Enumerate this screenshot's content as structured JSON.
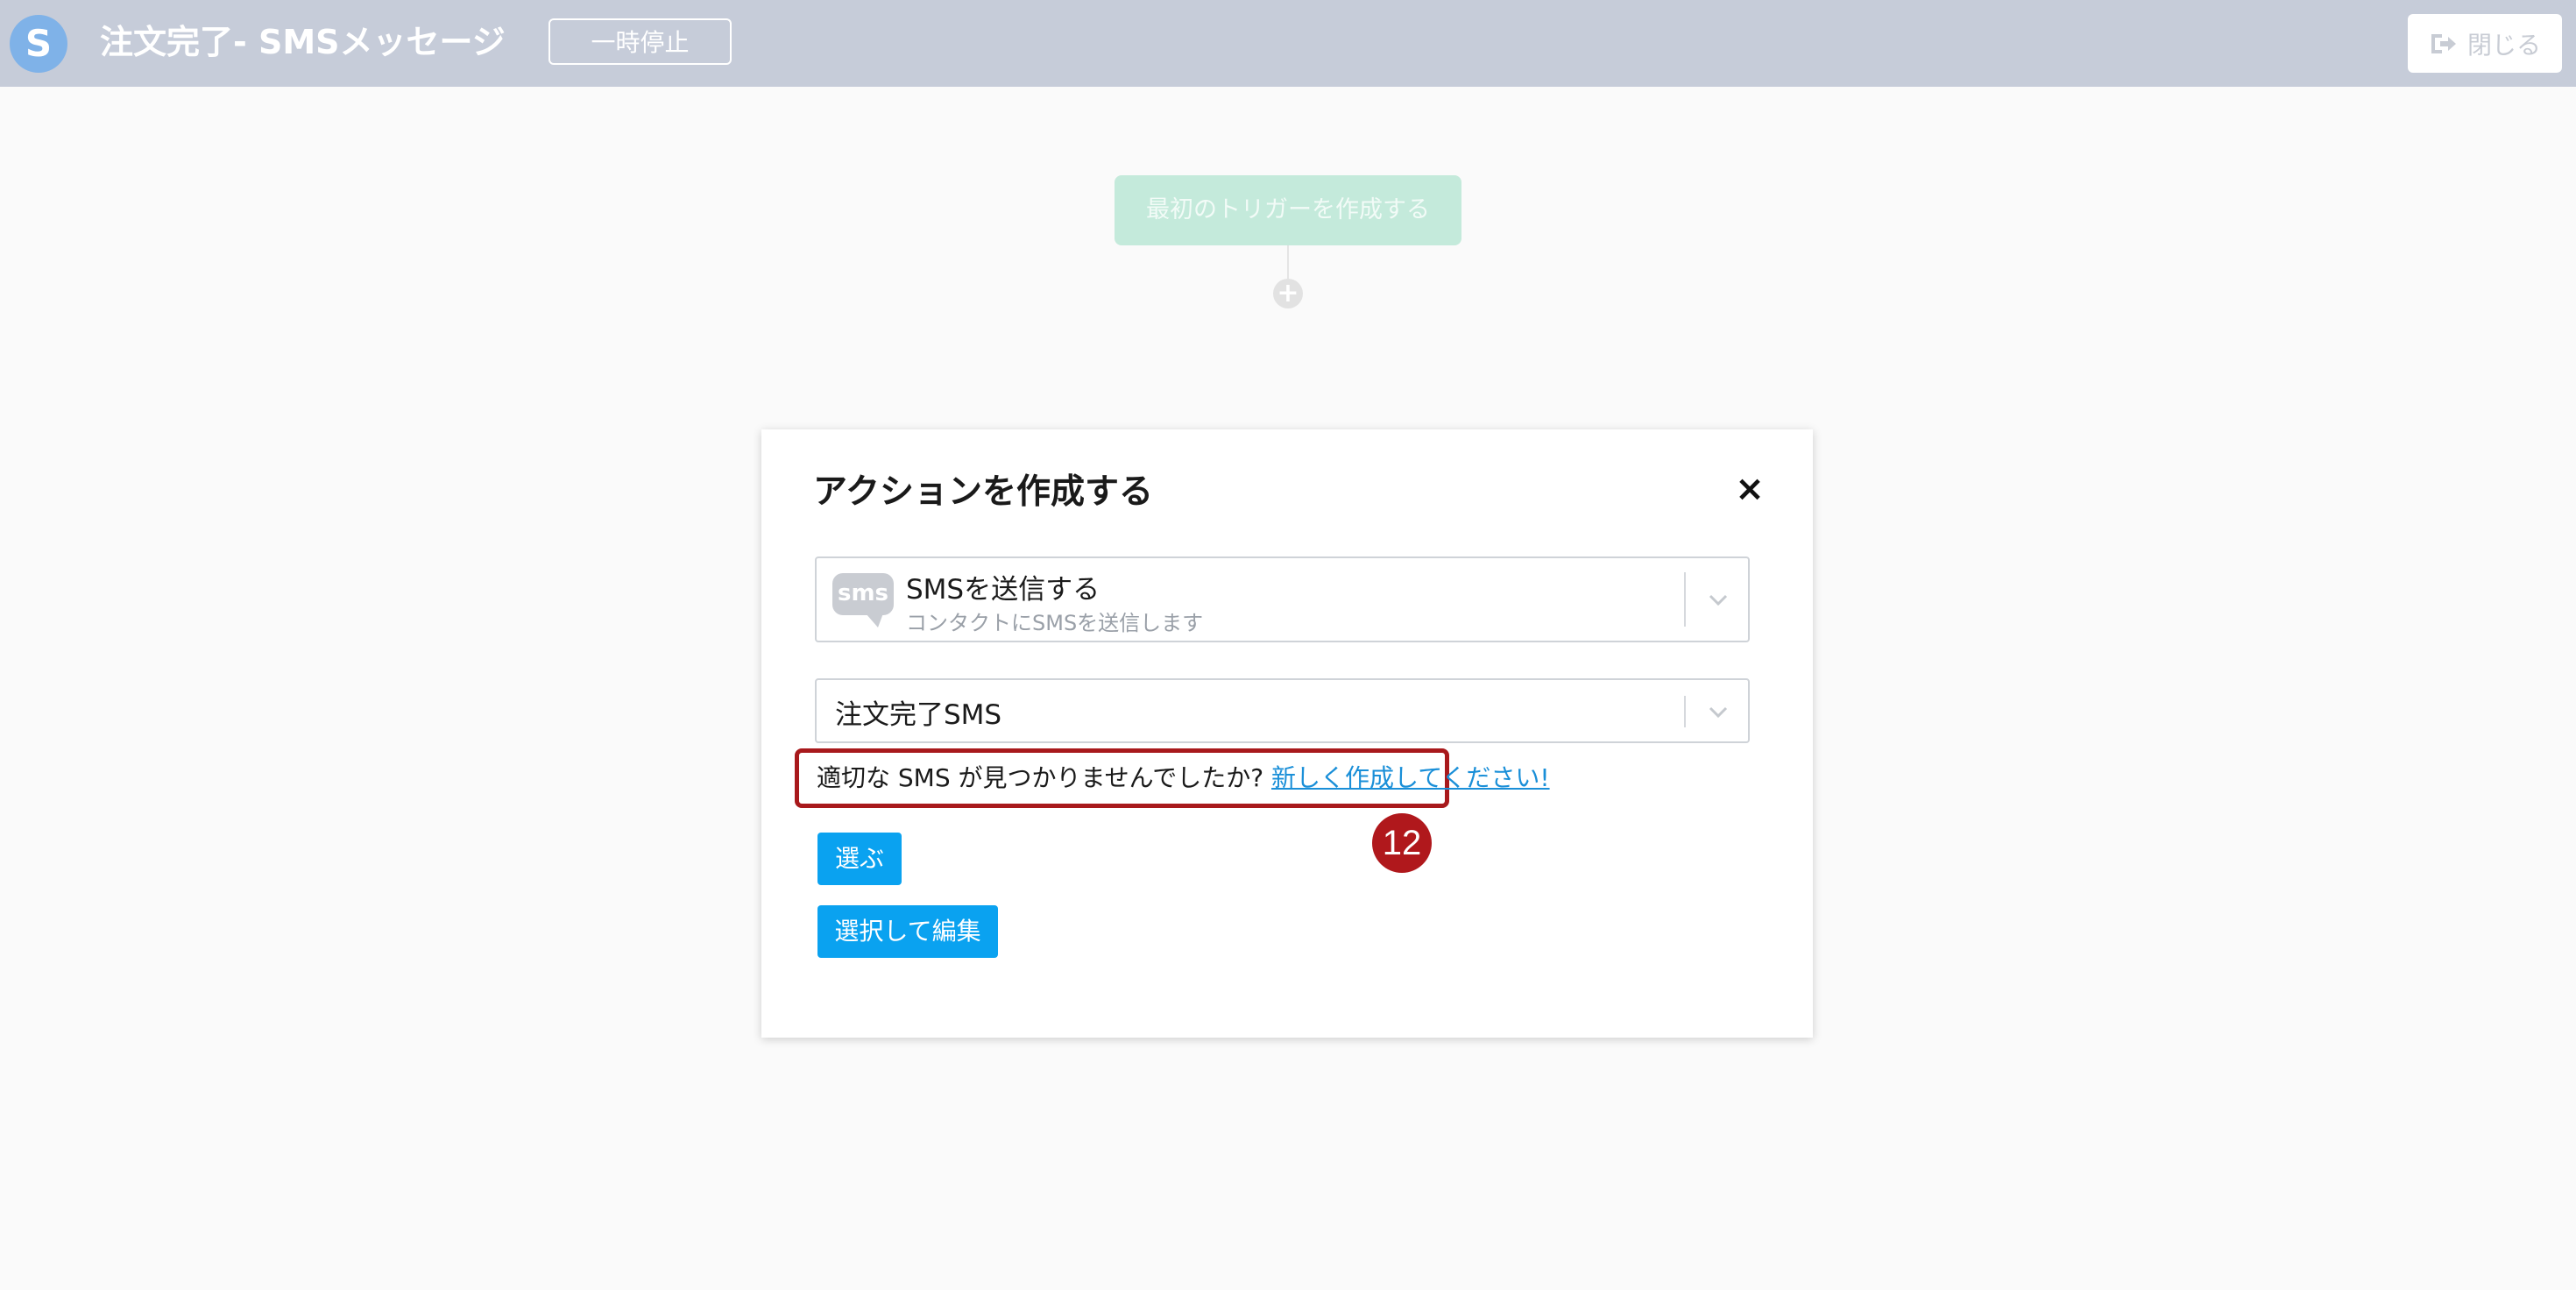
{
  "header": {
    "logo_letter": "S",
    "title": "注文完了- SMSメッセージ",
    "pause_label": "一時停止",
    "close_label": "閉じる"
  },
  "canvas": {
    "trigger_label": "最初のトリガーを作成する",
    "add_symbol": "+"
  },
  "modal": {
    "title": "アクションを作成する",
    "close_symbol": "×",
    "action_select": {
      "icon_text": "sms",
      "label": "SMSを送信する",
      "description": "コンタクトにSMSを送信します"
    },
    "sms_select": {
      "value": "注文完了SMS"
    },
    "not_found_text": "適切な SMS が見つかりませんでしたか? ",
    "create_link": "新しく作成してください!",
    "choose_button": "選ぶ",
    "choose_edit_button": "選択して編集"
  },
  "annotation": {
    "step_number": "12"
  },
  "colors": {
    "header_bg": "#c6ccd9",
    "primary": "#0aa2f0",
    "highlight": "#a8191c",
    "link": "#1a8fd8"
  }
}
